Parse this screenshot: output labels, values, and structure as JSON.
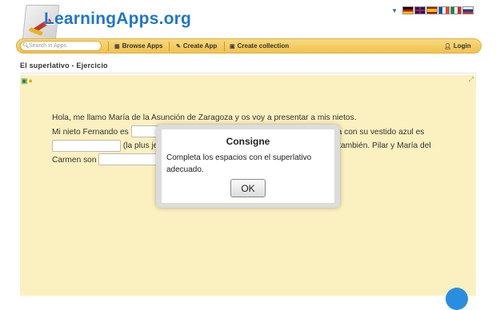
{
  "brand": {
    "name": "LearningApps.org"
  },
  "languages": {
    "dropdown_icon": "triangle-down-icon",
    "flags": [
      {
        "name": "flag-de",
        "colors": [
          "#000000",
          "#dd0000",
          "#ffce00"
        ]
      },
      {
        "name": "flag-gb",
        "colors": [
          "#012169",
          "#ffffff",
          "#c8102e"
        ]
      },
      {
        "name": "flag-es",
        "colors": [
          "#aa151b",
          "#f1bf00",
          "#aa151b"
        ]
      },
      {
        "name": "flag-fr",
        "colors": [
          "#0055a4",
          "#ffffff",
          "#ef4135"
        ]
      },
      {
        "name": "flag-it",
        "colors": [
          "#009246",
          "#ffffff",
          "#ce2b37"
        ]
      },
      {
        "name": "flag-ru",
        "colors": [
          "#ffffff",
          "#0039a6",
          "#d52b1e"
        ]
      }
    ]
  },
  "nav": {
    "search_placeholder": "Search in Apps",
    "browse": "Browse Apps",
    "create": "Create App",
    "collection": "Create collection",
    "login": "Login"
  },
  "page": {
    "title": "El superlativo - Ejercicio"
  },
  "exercise": {
    "line1": "Hola, me llamo María de la Asunción de Zaragoza y os voy a presentar a mis nietos.",
    "line2a": "Mi nieto Fernando es",
    "line2b": "María con su vestido azul es",
    "line3a": "(la plus je",
    "line3b": "también. Pilar y María del",
    "line4a": "Carmen son"
  },
  "modal": {
    "title": "Consigne",
    "body": "Completa los espacios con el superlativo adecuado.",
    "ok": "OK"
  },
  "colors": {
    "accent": "#1f77c9",
    "nav": "#f4c95a",
    "stage": "#fbf0bf",
    "action": "#2a8ee0"
  }
}
